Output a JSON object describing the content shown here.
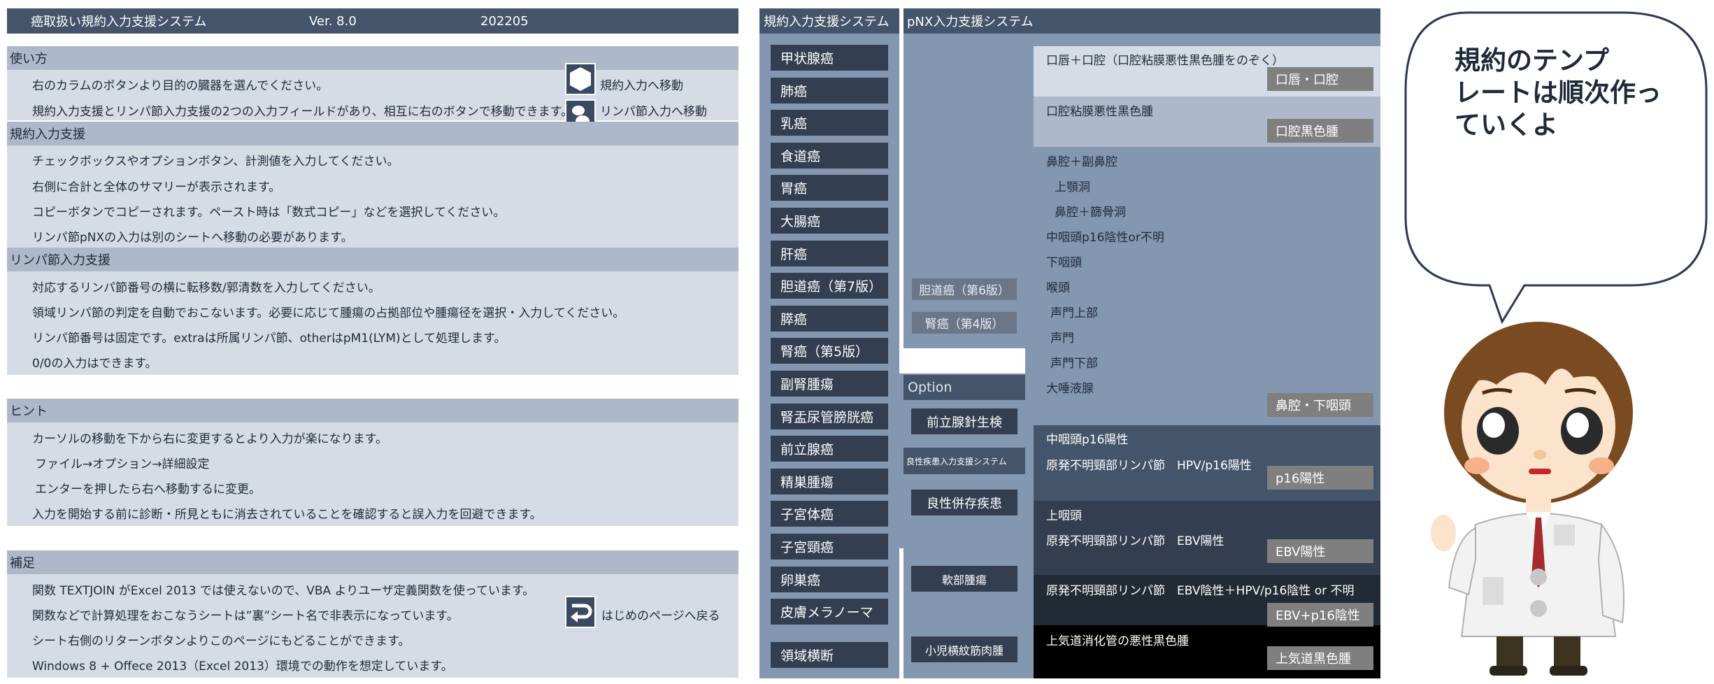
{
  "header": {
    "title": "癌取扱い規約入力支援システム",
    "version": "Ver. 8.0",
    "date": "202205"
  },
  "usage": {
    "heading": "使い方",
    "lines": [
      "右のカラムのボタンより目的の臓器を選んでください。",
      "規約入力支援とリンパ節入力支援の2つの入力フィールドがあり、相互に右のボタンで移動できます。"
    ],
    "nav_kiyaku_label": "規約入力へ移動",
    "nav_lymph_label": "リンパ節入力へ移動"
  },
  "kiyaku_support": {
    "heading": "規約入力支援",
    "lines": [
      "チェックボックスやオプションボタン、計測値を入力してください。",
      "右側に合計と全体のサマリーが表示されます。",
      "コピーボタンでコピーされます。ペースト時は「数式コピー」などを選択してください。",
      "リンパ節pNXの入力は別のシートへ移動の必要があります。"
    ]
  },
  "lymph_support": {
    "heading": "リンパ節入力支援",
    "lines": [
      "対応するリンパ節番号の横に転移数/郭清数を入力してください。",
      "領域リンパ節の判定を自動でおこないます。必要に応じて腫瘍の占拠部位や腫瘍径を選択・入力してください。",
      "リンパ節番号は固定です。extraは所属リンパ節、otherはpM1(LYM)として処理します。",
      "0/0の入力はできます。"
    ]
  },
  "hint": {
    "heading": "ヒント",
    "lines": [
      "カーソルの移動を下から右に変更するとより入力が楽になります。",
      "ファイル→オプション→詳細設定",
      "エンターを押したら右へ移動するに変更。",
      "入力を開始する前に診断・所見ともに消去されていることを確認すると誤入力を回避できます。"
    ]
  },
  "notes": {
    "heading": "補足",
    "lines": [
      "関数 TEXTJOIN がExcel 2013 では使えないので、VBA よりユーザ定義関数を使っています。",
      "関数などで計算処理をおこなうシートは”裏”シート名で非表示になっています。",
      "シート右側のリターンボタンよりこのページにもどることができます。",
      "Windows 8 + Offece 2013（Excel 2013）環境での動作を想定しています。"
    ],
    "return_label": "はじめのページへ戻る"
  },
  "kiyaku_panel": {
    "title": "規約入力支援システム",
    "organs": [
      "甲状腺癌",
      "肺癌",
      "乳癌",
      "食道癌",
      "胃癌",
      "大腸癌",
      "肝癌",
      "胆道癌（第7版）",
      "膵癌",
      "腎癌（第5版）",
      "副腎腫瘍",
      "腎盂尿管膀胱癌",
      "前立腺癌",
      "精巣腫瘍",
      "子宮体癌",
      "子宮頸癌",
      "卵巣癌",
      "皮膚メラノーマ",
      "領域横断"
    ],
    "mid_buttons": [
      "胆道癌（第6版）",
      "腎癌（第4版）"
    ],
    "option_label": "Option",
    "option_buttons": [
      "前立腺針生検"
    ],
    "benign_label": "良性疾患入力支援システム",
    "benign_buttons": [
      "良性併存疾患"
    ],
    "soft_tissue": "軟部腫瘍",
    "rhabdo": "小児横紋筋肉腫"
  },
  "pnx_panel": {
    "title": "pNX入力支援システム",
    "sections": [
      {
        "lines": [
          "口唇＋口腔（口腔粘膜悪性黒色腫をのぞく）"
        ],
        "button": "口唇・口腔"
      },
      {
        "lines": [
          "口腔粘膜悪性黒色腫"
        ],
        "button": "口腔黒色腫"
      },
      {
        "lines": [
          "鼻腔＋副鼻腔",
          "上顎洞",
          "鼻腔＋篩骨洞",
          "中咽頭p16陰性or不明",
          "下咽頭",
          "喉頭",
          "声門上部",
          "声門",
          "声門下部",
          "大唾液腺"
        ],
        "button": "鼻腔・下咽頭"
      },
      {
        "lines": [
          "中咽頭p16陽性",
          "原発不明頸部リンパ節　HPV/p16陽性"
        ],
        "button": "p16陽性"
      },
      {
        "lines": [
          "上咽頭",
          "原発不明頸部リンパ節　EBV陽性"
        ],
        "button": "EBV陽性"
      },
      {
        "lines": [
          "原発不明頸部リンパ節　EBV陰性＋HPV/p16陰性 or 不明"
        ],
        "button": "EBV+p16陰性"
      },
      {
        "lines": [
          "上気道消化管の悪性黒色腫"
        ],
        "button": "上気道黒色腫"
      }
    ]
  },
  "speech": {
    "lines": [
      "規約のテンプ",
      "レートは順次作っ",
      "ていくよ"
    ]
  },
  "colors": {
    "header_bg": "#44546a",
    "section_head": "#adb9ca",
    "section_body": "#d6dce5",
    "organ_button": "#333f50",
    "gray_button": "#7f7f7f"
  }
}
